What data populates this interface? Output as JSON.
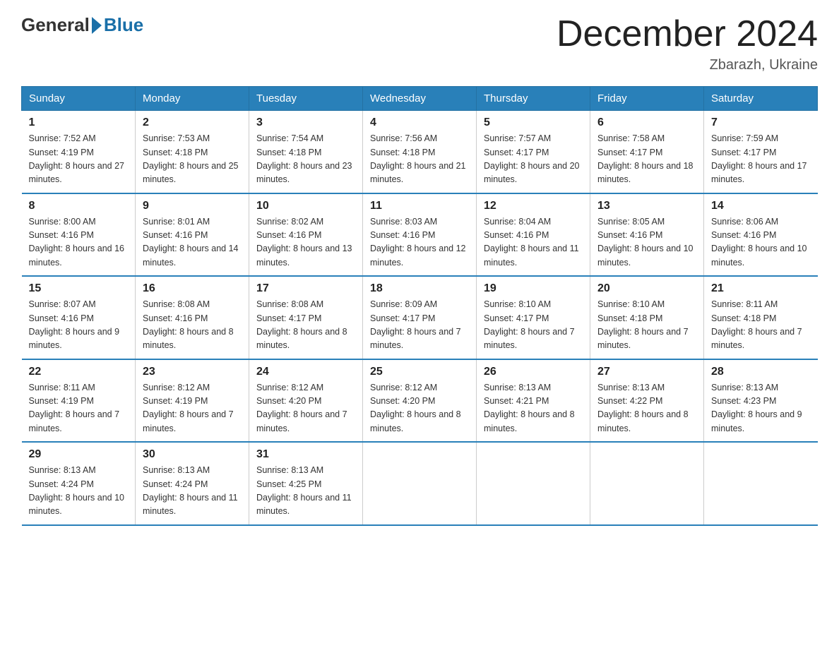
{
  "header": {
    "logo_general": "General",
    "logo_blue": "Blue",
    "title": "December 2024",
    "location": "Zbarazh, Ukraine"
  },
  "days_of_week": [
    "Sunday",
    "Monday",
    "Tuesday",
    "Wednesday",
    "Thursday",
    "Friday",
    "Saturday"
  ],
  "weeks": [
    [
      {
        "num": "1",
        "sunrise": "7:52 AM",
        "sunset": "4:19 PM",
        "daylight": "8 hours and 27 minutes."
      },
      {
        "num": "2",
        "sunrise": "7:53 AM",
        "sunset": "4:18 PM",
        "daylight": "8 hours and 25 minutes."
      },
      {
        "num": "3",
        "sunrise": "7:54 AM",
        "sunset": "4:18 PM",
        "daylight": "8 hours and 23 minutes."
      },
      {
        "num": "4",
        "sunrise": "7:56 AM",
        "sunset": "4:18 PM",
        "daylight": "8 hours and 21 minutes."
      },
      {
        "num": "5",
        "sunrise": "7:57 AM",
        "sunset": "4:17 PM",
        "daylight": "8 hours and 20 minutes."
      },
      {
        "num": "6",
        "sunrise": "7:58 AM",
        "sunset": "4:17 PM",
        "daylight": "8 hours and 18 minutes."
      },
      {
        "num": "7",
        "sunrise": "7:59 AM",
        "sunset": "4:17 PM",
        "daylight": "8 hours and 17 minutes."
      }
    ],
    [
      {
        "num": "8",
        "sunrise": "8:00 AM",
        "sunset": "4:16 PM",
        "daylight": "8 hours and 16 minutes."
      },
      {
        "num": "9",
        "sunrise": "8:01 AM",
        "sunset": "4:16 PM",
        "daylight": "8 hours and 14 minutes."
      },
      {
        "num": "10",
        "sunrise": "8:02 AM",
        "sunset": "4:16 PM",
        "daylight": "8 hours and 13 minutes."
      },
      {
        "num": "11",
        "sunrise": "8:03 AM",
        "sunset": "4:16 PM",
        "daylight": "8 hours and 12 minutes."
      },
      {
        "num": "12",
        "sunrise": "8:04 AM",
        "sunset": "4:16 PM",
        "daylight": "8 hours and 11 minutes."
      },
      {
        "num": "13",
        "sunrise": "8:05 AM",
        "sunset": "4:16 PM",
        "daylight": "8 hours and 10 minutes."
      },
      {
        "num": "14",
        "sunrise": "8:06 AM",
        "sunset": "4:16 PM",
        "daylight": "8 hours and 10 minutes."
      }
    ],
    [
      {
        "num": "15",
        "sunrise": "8:07 AM",
        "sunset": "4:16 PM",
        "daylight": "8 hours and 9 minutes."
      },
      {
        "num": "16",
        "sunrise": "8:08 AM",
        "sunset": "4:16 PM",
        "daylight": "8 hours and 8 minutes."
      },
      {
        "num": "17",
        "sunrise": "8:08 AM",
        "sunset": "4:17 PM",
        "daylight": "8 hours and 8 minutes."
      },
      {
        "num": "18",
        "sunrise": "8:09 AM",
        "sunset": "4:17 PM",
        "daylight": "8 hours and 7 minutes."
      },
      {
        "num": "19",
        "sunrise": "8:10 AM",
        "sunset": "4:17 PM",
        "daylight": "8 hours and 7 minutes."
      },
      {
        "num": "20",
        "sunrise": "8:10 AM",
        "sunset": "4:18 PM",
        "daylight": "8 hours and 7 minutes."
      },
      {
        "num": "21",
        "sunrise": "8:11 AM",
        "sunset": "4:18 PM",
        "daylight": "8 hours and 7 minutes."
      }
    ],
    [
      {
        "num": "22",
        "sunrise": "8:11 AM",
        "sunset": "4:19 PM",
        "daylight": "8 hours and 7 minutes."
      },
      {
        "num": "23",
        "sunrise": "8:12 AM",
        "sunset": "4:19 PM",
        "daylight": "8 hours and 7 minutes."
      },
      {
        "num": "24",
        "sunrise": "8:12 AM",
        "sunset": "4:20 PM",
        "daylight": "8 hours and 7 minutes."
      },
      {
        "num": "25",
        "sunrise": "8:12 AM",
        "sunset": "4:20 PM",
        "daylight": "8 hours and 8 minutes."
      },
      {
        "num": "26",
        "sunrise": "8:13 AM",
        "sunset": "4:21 PM",
        "daylight": "8 hours and 8 minutes."
      },
      {
        "num": "27",
        "sunrise": "8:13 AM",
        "sunset": "4:22 PM",
        "daylight": "8 hours and 8 minutes."
      },
      {
        "num": "28",
        "sunrise": "8:13 AM",
        "sunset": "4:23 PM",
        "daylight": "8 hours and 9 minutes."
      }
    ],
    [
      {
        "num": "29",
        "sunrise": "8:13 AM",
        "sunset": "4:24 PM",
        "daylight": "8 hours and 10 minutes."
      },
      {
        "num": "30",
        "sunrise": "8:13 AM",
        "sunset": "4:24 PM",
        "daylight": "8 hours and 11 minutes."
      },
      {
        "num": "31",
        "sunrise": "8:13 AM",
        "sunset": "4:25 PM",
        "daylight": "8 hours and 11 minutes."
      },
      null,
      null,
      null,
      null
    ]
  ],
  "labels": {
    "sunrise": "Sunrise:",
    "sunset": "Sunset:",
    "daylight": "Daylight:"
  }
}
